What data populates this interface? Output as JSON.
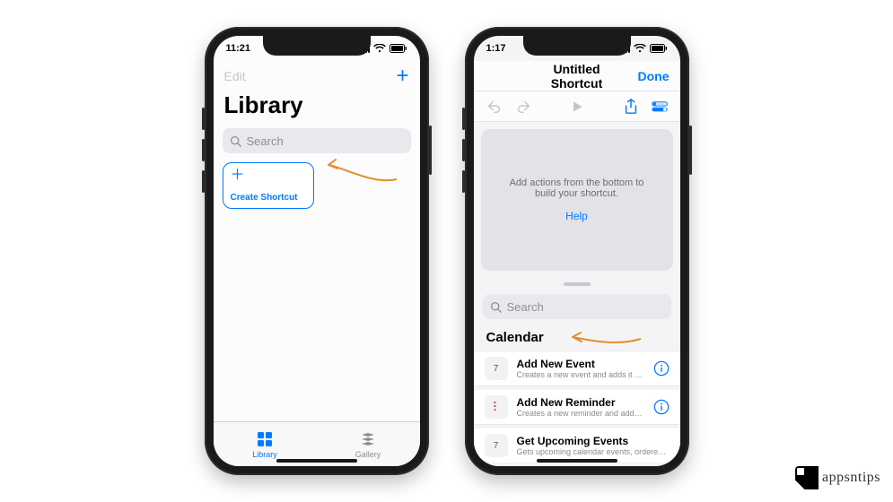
{
  "left": {
    "status": {
      "time": "11:21"
    },
    "nav": {
      "edit": "Edit"
    },
    "title": "Library",
    "search": {
      "placeholder": "Search"
    },
    "card": {
      "label": "Create Shortcut"
    },
    "tabs": {
      "library": "Library",
      "gallery": "Gallery"
    }
  },
  "right": {
    "status": {
      "time": "1:17"
    },
    "nav": {
      "title": "Untitled Shortcut",
      "done": "Done"
    },
    "canvas": {
      "hint": "Add actions from the bottom to build your shortcut.",
      "help": "Help"
    },
    "panel": {
      "search_placeholder": "Search",
      "section": "Calendar",
      "actions": [
        {
          "title": "Add New Event",
          "sub": "Creates a new event and adds it to the sel…",
          "icon": "7"
        },
        {
          "title": "Add New Reminder",
          "sub": "Creates a new reminder and adds it to the…",
          "icon": "•"
        },
        {
          "title": "Get Upcoming Events",
          "sub": "Gets upcoming calendar events, ordered fr…",
          "icon": "7"
        }
      ]
    }
  },
  "watermark": "appsntips"
}
